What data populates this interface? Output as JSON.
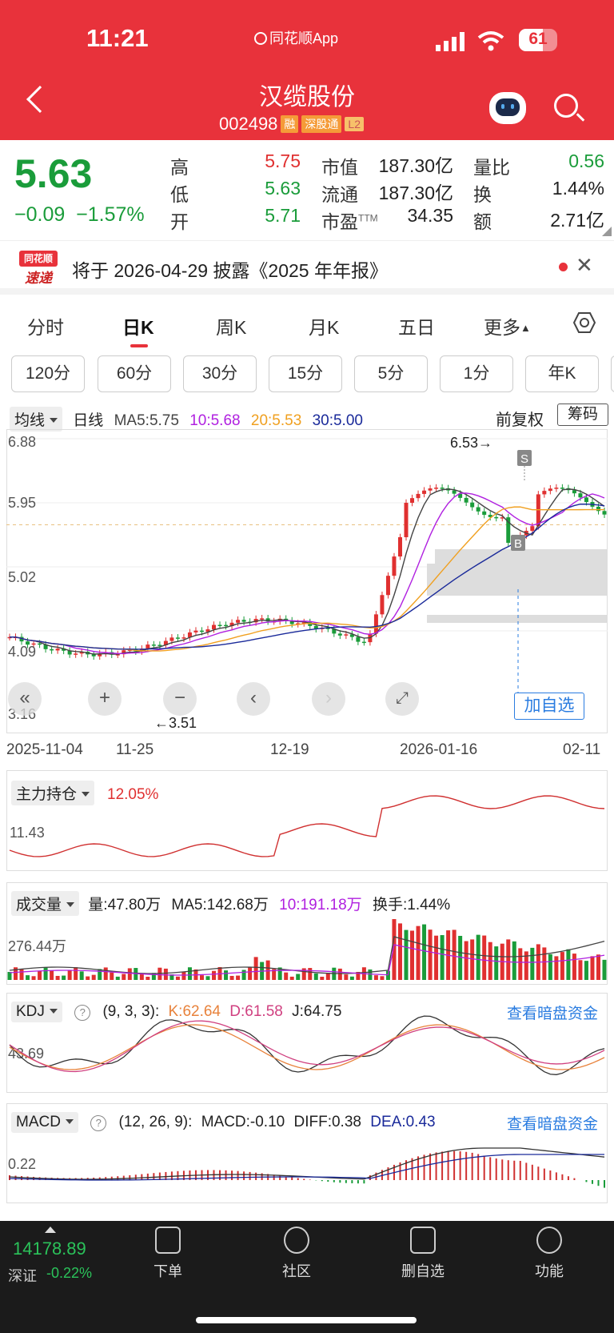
{
  "status": {
    "time": "11:21",
    "app_name": "同花顺App",
    "battery": "61"
  },
  "stock": {
    "name": "汉缆股份",
    "code": "002498",
    "tags": [
      "融",
      "深股通",
      "L2"
    ]
  },
  "quote": {
    "price": "5.63",
    "change": "−0.09",
    "change_pct": "−1.57%",
    "high_label": "高",
    "high": "5.75",
    "low_label": "低",
    "low": "5.63",
    "open_label": "开",
    "open": "5.71",
    "mcap_label": "市值",
    "mcap": "187.30亿",
    "float_label": "流通",
    "float": "187.30亿",
    "pe_label": "市盈",
    "pe_sup": "TTM",
    "pe": "34.35",
    "vr_label": "量比",
    "vr": "0.56",
    "turn_label": "换",
    "turn": "1.44%",
    "amt_label": "额",
    "amt": "2.71亿"
  },
  "notice": {
    "logo_top": "同花顺",
    "logo_bottom": "速递",
    "text": "将于 2026-04-29 披露《2025 年年报》"
  },
  "period_tabs": [
    "分时",
    "日K",
    "周K",
    "月K",
    "五日",
    "更多"
  ],
  "interval_tabs": [
    "120分",
    "60分",
    "30分",
    "15分",
    "5分",
    "1分",
    "年K"
  ],
  "ma_bar": {
    "type": "均线",
    "period": "日线",
    "ma5": "MA5:5.75",
    "ma10": "10:5.68",
    "ma20": "20:5.53",
    "ma30": "30:5.00",
    "adjust": "前复权",
    "chip": "筹码"
  },
  "kchart": {
    "y_labels": [
      "6.88",
      "5.95",
      "5.02",
      "4.09",
      "3.16"
    ],
    "dates": [
      "2025-11-04",
      "11-25",
      "12-19",
      "2026-01-16",
      "02-11"
    ],
    "high_annot": "6.53→",
    "low_annot": "←3.51",
    "add_watch": "加自选",
    "buy_mark": "B",
    "sell_mark": "S"
  },
  "hold": {
    "title": "主力持仓",
    "value": "12.05%",
    "axis": "11.43"
  },
  "volume": {
    "title": "成交量",
    "vol": "量:47.80万",
    "ma5": "MA5:142.68万",
    "ma10": "10:191.18万",
    "turnover": "换手:1.44%",
    "axis": "276.44万"
  },
  "kdj": {
    "title": "KDJ",
    "params": "(9, 3, 3):",
    "k": "K:62.64",
    "d": "D:61.58",
    "j": "J:64.75",
    "link": "查看暗盘资金",
    "axis": "43.69"
  },
  "macd": {
    "title": "MACD",
    "params": "(12, 26, 9):",
    "macd": "MACD:-0.10",
    "diff": "DIFF:0.38",
    "dea": "DEA:0.43",
    "link": "查看暗盘资金",
    "axis": "0.22"
  },
  "bottom": {
    "index_value": "14178.89",
    "index_name": "深证",
    "index_change": "-0.22%",
    "nav": [
      "下单",
      "社区",
      "删自选",
      "功能"
    ]
  },
  "colors": {
    "header": "#e8323b",
    "up": "#e03030",
    "down": "#1a9c3a",
    "ma5": "#444444",
    "ma10": "#b020e0",
    "ma20": "#f0a020",
    "ma30": "#1a2a9a"
  }
}
